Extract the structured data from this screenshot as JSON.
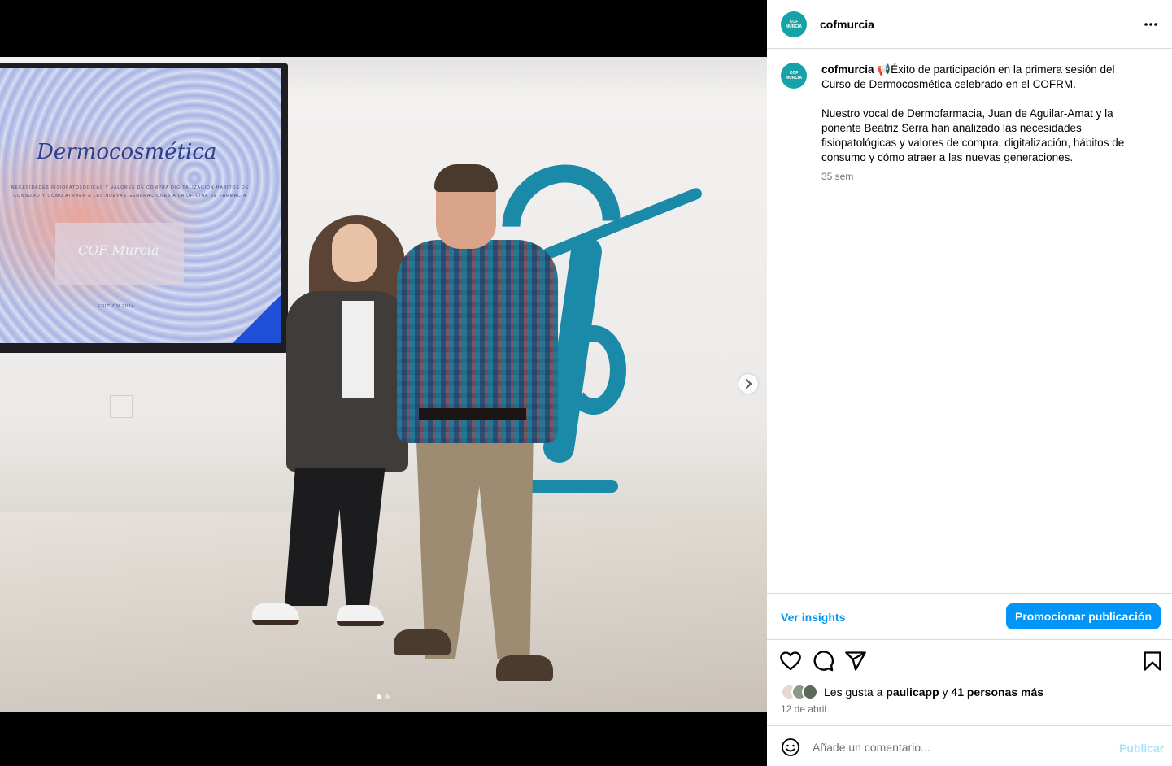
{
  "post": {
    "username": "cofmurcia",
    "avatar_text_top": "COF",
    "avatar_text_bottom": "MURCIA",
    "caption_text": " 📢Éxito de participación en la primera sesión del Curso de Dermocosmética celebrado en el COFRM.\n\nNuestro vocal de Dermofarmacia, Juan de Aguilar-Amat y la ponente Beatriz Serra han analizado las necesidades fisiopatológicas y valores de compra, digitalización, hábitos de consumo y cómo atraer a las nuevas generaciones.",
    "time_ago": "35 sem",
    "likes_prefix": "Les gusta a ",
    "likes_user": "paulicapp",
    "likes_mid": " y ",
    "likes_others": "41 personas más",
    "date": "12 de abril"
  },
  "photo": {
    "screen_title": "Dermocosmética",
    "screen_subtitle": "NECESIDADES FISIOPATOLÓGICAS Y VALORES DE COMPRA DIGITALIZACIÓN HÁBITOS DE CONSUMO Y CÓMO ATRAER A LAS NUEVAS GENERACIONES A LA OFICINA DE FARMACIA",
    "screen_box": "COF Murcia",
    "screen_footer": "EDICIÓN 2024",
    "carousel_count": 2,
    "carousel_active": 1
  },
  "actions": {
    "insights": "Ver insights",
    "promote": "Promocionar publicación",
    "comment_placeholder": "Añade un comentario...",
    "publish": "Publicar"
  },
  "icons": [
    "more-icon",
    "heart-icon",
    "comment-icon",
    "share-icon",
    "bookmark-icon",
    "emoji-icon",
    "chevron-right-icon"
  ],
  "colors": {
    "accent": "#0095f6",
    "brand_teal": "#16a3a8",
    "muted_text": "#737373",
    "publish_disabled": "#b2dffc"
  }
}
